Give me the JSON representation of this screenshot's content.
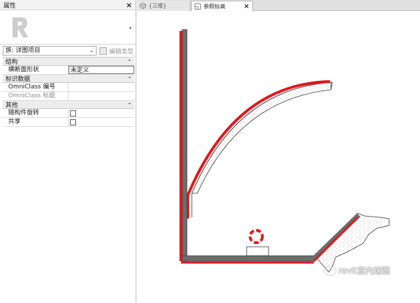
{
  "properties": {
    "title": "属性",
    "close_icon": "×",
    "family_select": "族: 详图项目",
    "edit_type": "编辑类型",
    "sections": {
      "structure": "结构",
      "identity": "标识数据",
      "other": "其他"
    },
    "rows": {
      "cross_section_label": "横断面形状",
      "cross_section_value": "未定义",
      "omniclass_number": "OmniClass 编号",
      "omniclass_title": "OmniClass 标题",
      "rotate_with_component": "随构件旋转",
      "shared": "共享"
    }
  },
  "tabs": {
    "tab_3d": "{三维}",
    "tab_ref": "参照标高",
    "close": "×"
  },
  "watermark": "revit室内速图",
  "colors": {
    "highlight": "#e3161b",
    "wall": "#6d6d6d",
    "bg": "#ffffff"
  }
}
